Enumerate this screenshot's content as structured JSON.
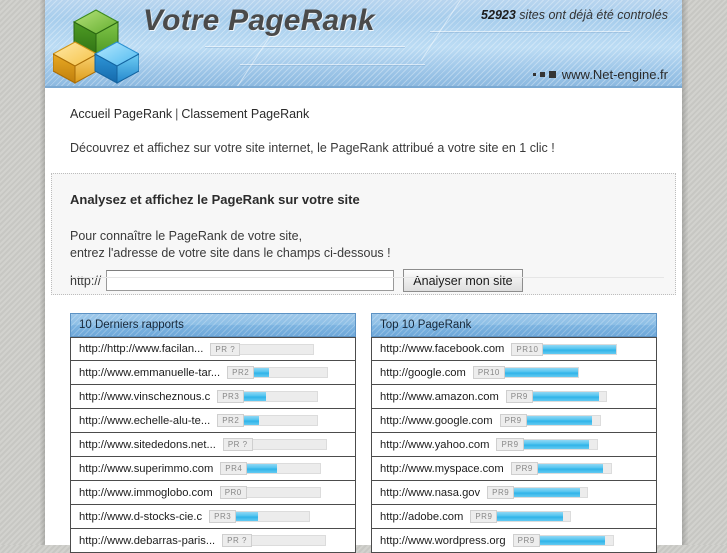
{
  "header": {
    "site_title": "Votre PageRank",
    "counter_number": "52923",
    "counter_text": " sites ont déjà été controlés",
    "brand": "www.Net-engine.fr"
  },
  "nav": {
    "home_label": "Accueil PageRank",
    "separator": "|",
    "ranking_label": "Classement PageRank"
  },
  "intro": {
    "text": "Découvrez et affichez sur votre site internet, le PageRank attribué a votre site en 1 clic !"
  },
  "analyze": {
    "title": "Analysez et affichez le PageRank sur votre site",
    "line1": "Pour connaître le PageRank de votre site,",
    "line2": "entrez l'adresse de votre site dans le champs ci-dessous !",
    "protocol_label": "http://",
    "input_value": "",
    "input_placeholder": "",
    "submit_label": "Analyser mon site"
  },
  "colors": {
    "header_blue": "#8dbfe6",
    "bar_fill": "#4fc3ef",
    "page_bg": "#ffffff",
    "box_bg": "#f7f7f7"
  },
  "tables": {
    "left": {
      "title": "10 Derniers rapports",
      "rows": [
        {
          "url": "http://http://www.facilan...",
          "pr_label": "PR ?",
          "pr_value": 0
        },
        {
          "url": "http://www.emmanuelle-tar...",
          "pr_label": "PR2",
          "pr_value": 2
        },
        {
          "url": "http://www.vinscheznous.c",
          "pr_label": "PR3",
          "pr_value": 3
        },
        {
          "url": "http://www.echelle-alu-te...",
          "pr_label": "PR2",
          "pr_value": 2
        },
        {
          "url": "http://www.sitededons.net...",
          "pr_label": "PR ?",
          "pr_value": 0
        },
        {
          "url": "http://www.superimmo.com",
          "pr_label": "PR4",
          "pr_value": 4
        },
        {
          "url": "http://www.immoglobo.com",
          "pr_label": "PR0",
          "pr_value": 0
        },
        {
          "url": "http://www.d-stocks-cie.c",
          "pr_label": "PR3",
          "pr_value": 3
        },
        {
          "url": "http://www.debarras-paris...",
          "pr_label": "PR ?",
          "pr_value": 0
        }
      ]
    },
    "right": {
      "title": "Top 10 PageRank",
      "rows": [
        {
          "url": "http://www.facebook.com",
          "pr_label": "PR10",
          "pr_value": 10
        },
        {
          "url": "http://google.com",
          "pr_label": "PR10",
          "pr_value": 10
        },
        {
          "url": "http://www.amazon.com",
          "pr_label": "PR9",
          "pr_value": 9
        },
        {
          "url": "http://www.google.com",
          "pr_label": "PR9",
          "pr_value": 9
        },
        {
          "url": "http://www.yahoo.com",
          "pr_label": "PR9",
          "pr_value": 9
        },
        {
          "url": "http://www.myspace.com",
          "pr_label": "PR9",
          "pr_value": 9
        },
        {
          "url": "http://www.nasa.gov",
          "pr_label": "PR9",
          "pr_value": 9
        },
        {
          "url": "http://adobe.com",
          "pr_label": "PR9",
          "pr_value": 9
        },
        {
          "url": "http://www.wordpress.org",
          "pr_label": "PR9",
          "pr_value": 9
        }
      ]
    }
  }
}
